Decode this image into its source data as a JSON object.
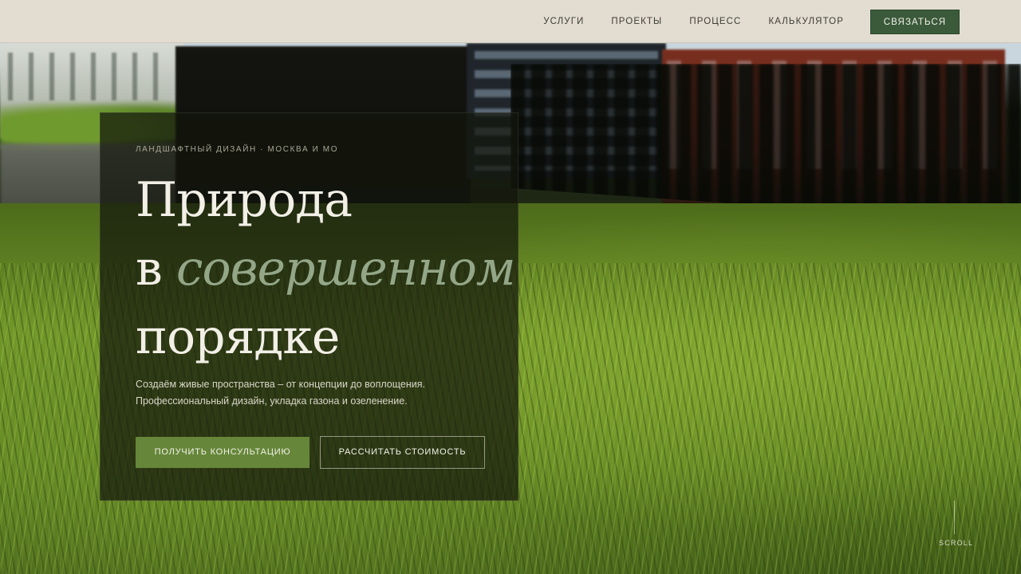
{
  "nav": {
    "links": [
      {
        "label": "Услуги"
      },
      {
        "label": "Проекты"
      },
      {
        "label": "Процесс"
      },
      {
        "label": "Калькулятор"
      }
    ],
    "cta_label": "Связаться"
  },
  "hero": {
    "eyebrow": "Ландшафтный дизайн · Москва и МО",
    "headline": {
      "line1": "Природа",
      "line2_prefix": "в ",
      "line2_accent": "совершенном",
      "line3": "порядке"
    },
    "subtitle": {
      "line1": "Создаём живые пространства – от концепции до воплощения.",
      "line2": "Профессиональный дизайн, укладка газона и озеленение."
    },
    "primary_button": "Получить консультацию",
    "secondary_button": "Рассчитать стоимость"
  },
  "scroll_label": "Scroll",
  "colors": {
    "header_bg": "#e3ddd1",
    "cta_green": "#3a5a3a",
    "primary_green": "#66873a",
    "accent_sage": "#93a688"
  }
}
